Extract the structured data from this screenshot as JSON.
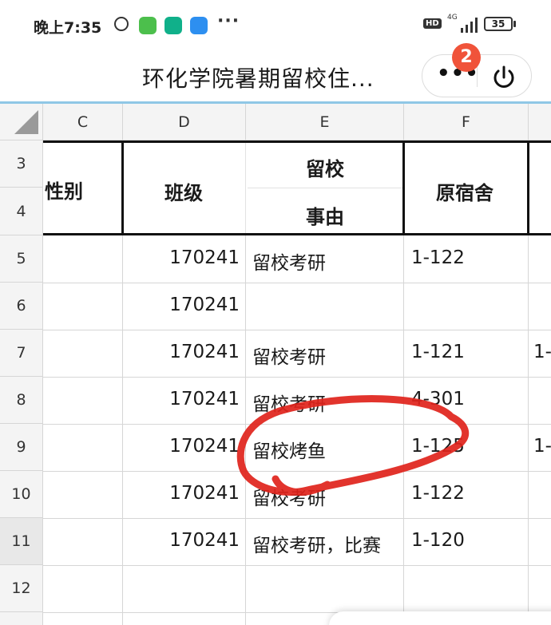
{
  "status_bar": {
    "time": "晚上7:35",
    "hd": "HD",
    "network": "4G",
    "battery": "35"
  },
  "title_bar": {
    "title": "环化学院暑期留校住...",
    "badge_count": "2"
  },
  "columns": [
    "C",
    "D",
    "E",
    "F"
  ],
  "rows": [
    "3",
    "4",
    "5",
    "6",
    "7",
    "8",
    "9",
    "10",
    "11",
    "12"
  ],
  "headers": {
    "gender": "性别",
    "class": "班级",
    "reason_line1": "留校",
    "reason_line2": "事由",
    "dorm": "原宿舍"
  },
  "data_rows": [
    {
      "row": "5",
      "class": "170241",
      "reason": "留校考研",
      "dorm": "1-122",
      "extra": ""
    },
    {
      "row": "6",
      "class": "170241",
      "reason": "",
      "dorm": "",
      "extra": ""
    },
    {
      "row": "7",
      "class": "170241",
      "reason": "留校考研",
      "dorm": "1-121",
      "extra": "1-"
    },
    {
      "row": "8",
      "class": "170241",
      "reason": "留校考研",
      "dorm": "4-301",
      "extra": ""
    },
    {
      "row": "9",
      "class": "170241",
      "reason": "留校烤鱼",
      "dorm": "1-125",
      "extra": "1-"
    },
    {
      "row": "10",
      "class": "170241",
      "reason": "留校考研",
      "dorm": "1-122",
      "extra": ""
    },
    {
      "row": "11",
      "class": "170241",
      "reason": "留校考研，比赛",
      "dorm": "1-120",
      "extra": ""
    }
  ],
  "annotation": {
    "color": "#e0231b"
  }
}
